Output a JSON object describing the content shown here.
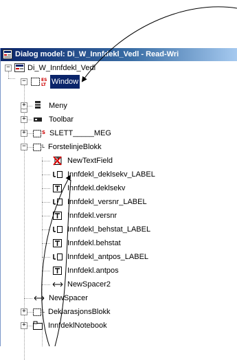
{
  "window": {
    "title": "Dialog model: Di_W_Innfdekl_Vedl - Read-Wri"
  },
  "tree": {
    "root": {
      "label": "Di_W_Innfdekl_Vedl",
      "expander": "−"
    },
    "window_node": {
      "label": "Window",
      "expander": "−",
      "badge_top": "ES",
      "badge_bottom": "LT"
    },
    "meny": {
      "label": "Meny",
      "expander": "+"
    },
    "toolbar": {
      "label": "Toolbar",
      "expander": "+"
    },
    "slett": {
      "label": "SLETT_____MEG",
      "expander": "+",
      "badge": "S"
    },
    "forstelinje": {
      "label": "ForstelinjeBlokk",
      "expander": "−",
      "badge": "L"
    },
    "children": [
      {
        "label": "NewTextField",
        "icon": "red-x-textfield-icon"
      },
      {
        "label": "Innfdekl_deklsekv_LABEL",
        "icon": "label-icon"
      },
      {
        "label": "Innfdekl.deklsekv",
        "icon": "textfield-icon"
      },
      {
        "label": "Innfdekl_versnr_LABEL",
        "icon": "label-icon"
      },
      {
        "label": "Innfdekl.versnr",
        "icon": "textfield-icon"
      },
      {
        "label": "Innfdekl_behstat_LABEL",
        "icon": "label-icon"
      },
      {
        "label": "Innfdekl.behstat",
        "icon": "textfield-icon"
      },
      {
        "label": "Innfdekl_antpos_LABEL",
        "icon": "label-icon"
      },
      {
        "label": "Innfdekl.antpos",
        "icon": "textfield-icon"
      },
      {
        "label": "NewSpacer2",
        "icon": "spacer-icon"
      }
    ],
    "newspacer": {
      "label": "NewSpacer"
    },
    "deklarasjon": {
      "label": "DeklarasjonsBlokk",
      "expander": "+",
      "badge": "L"
    },
    "notebook": {
      "label": "InnfdeklNotebook",
      "expander": "+"
    }
  }
}
